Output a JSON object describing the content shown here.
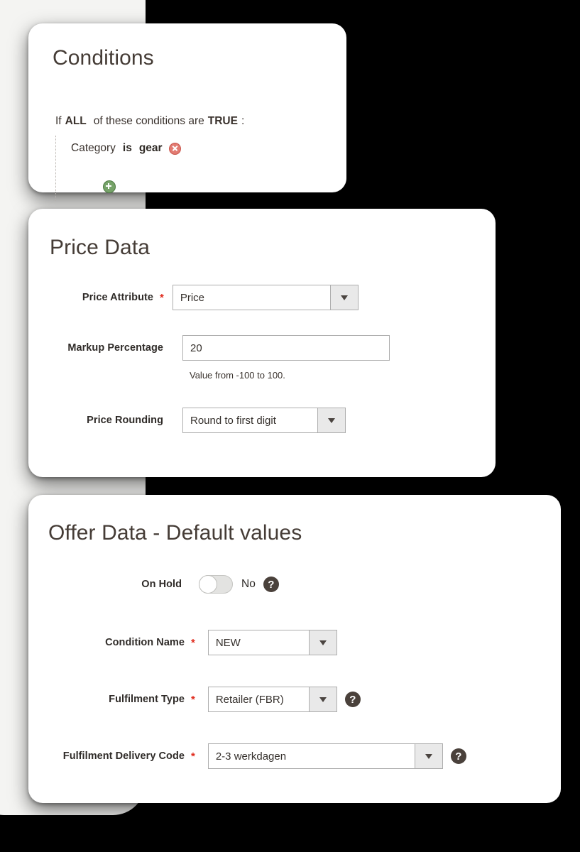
{
  "theme": {
    "page_background": "#000000",
    "side_panel": "#f4f4f2",
    "card_background": "#ffffff",
    "title_color": "#453c36",
    "label_color": "#2f2b28",
    "required_star_color": "#e02b1d",
    "help_icon_color": "#4a413b",
    "add_icon_color": "#76a369",
    "remove_icon_color": "#e27b72"
  },
  "conditions_card": {
    "title": "Conditions",
    "intro": {
      "if": "If",
      "quantifier": "ALL",
      "middle": "of these conditions are",
      "truth": "TRUE",
      "colon": ":"
    },
    "rules": [
      {
        "attribute": "Category",
        "operator": "is",
        "value": "gear",
        "remove_icon": "remove-circle-icon"
      }
    ],
    "add_icon": "add-circle-icon"
  },
  "price_card": {
    "title": "Price Data",
    "fields": {
      "price_attribute": {
        "label": "Price Attribute",
        "required": true,
        "type": "select",
        "value": "Price",
        "caret_icon": "chevron-down-icon"
      },
      "markup_percentage": {
        "label": "Markup Percentage",
        "required": false,
        "type": "text",
        "value": "20",
        "hint": "Value from -100 to 100."
      },
      "price_rounding": {
        "label": "Price Rounding",
        "required": false,
        "type": "select",
        "value": "Round to first digit",
        "caret_icon": "chevron-down-icon"
      }
    }
  },
  "offer_card": {
    "title": "Offer Data - Default values",
    "fields": {
      "on_hold": {
        "label": "On Hold",
        "required": false,
        "type": "toggle",
        "state": "off",
        "value_text": "No",
        "help_icon": "question-mark-icon",
        "has_help": true
      },
      "condition_name": {
        "label": "Condition Name",
        "required": true,
        "type": "select",
        "value": "NEW",
        "caret_icon": "chevron-down-icon",
        "has_help": false
      },
      "fulfilment_type": {
        "label": "Fulfilment Type",
        "required": true,
        "type": "select",
        "value": "Retailer (FBR)",
        "caret_icon": "chevron-down-icon",
        "help_icon": "question-mark-icon",
        "has_help": true
      },
      "fulfilment_delivery_code": {
        "label": "Fulfilment Delivery Code",
        "required": true,
        "type": "select",
        "value": "2-3 werkdagen",
        "caret_icon": "chevron-down-icon",
        "help_icon": "question-mark-icon",
        "has_help": true
      }
    }
  },
  "symbols": {
    "required_star": "*",
    "help_glyph": "?"
  }
}
